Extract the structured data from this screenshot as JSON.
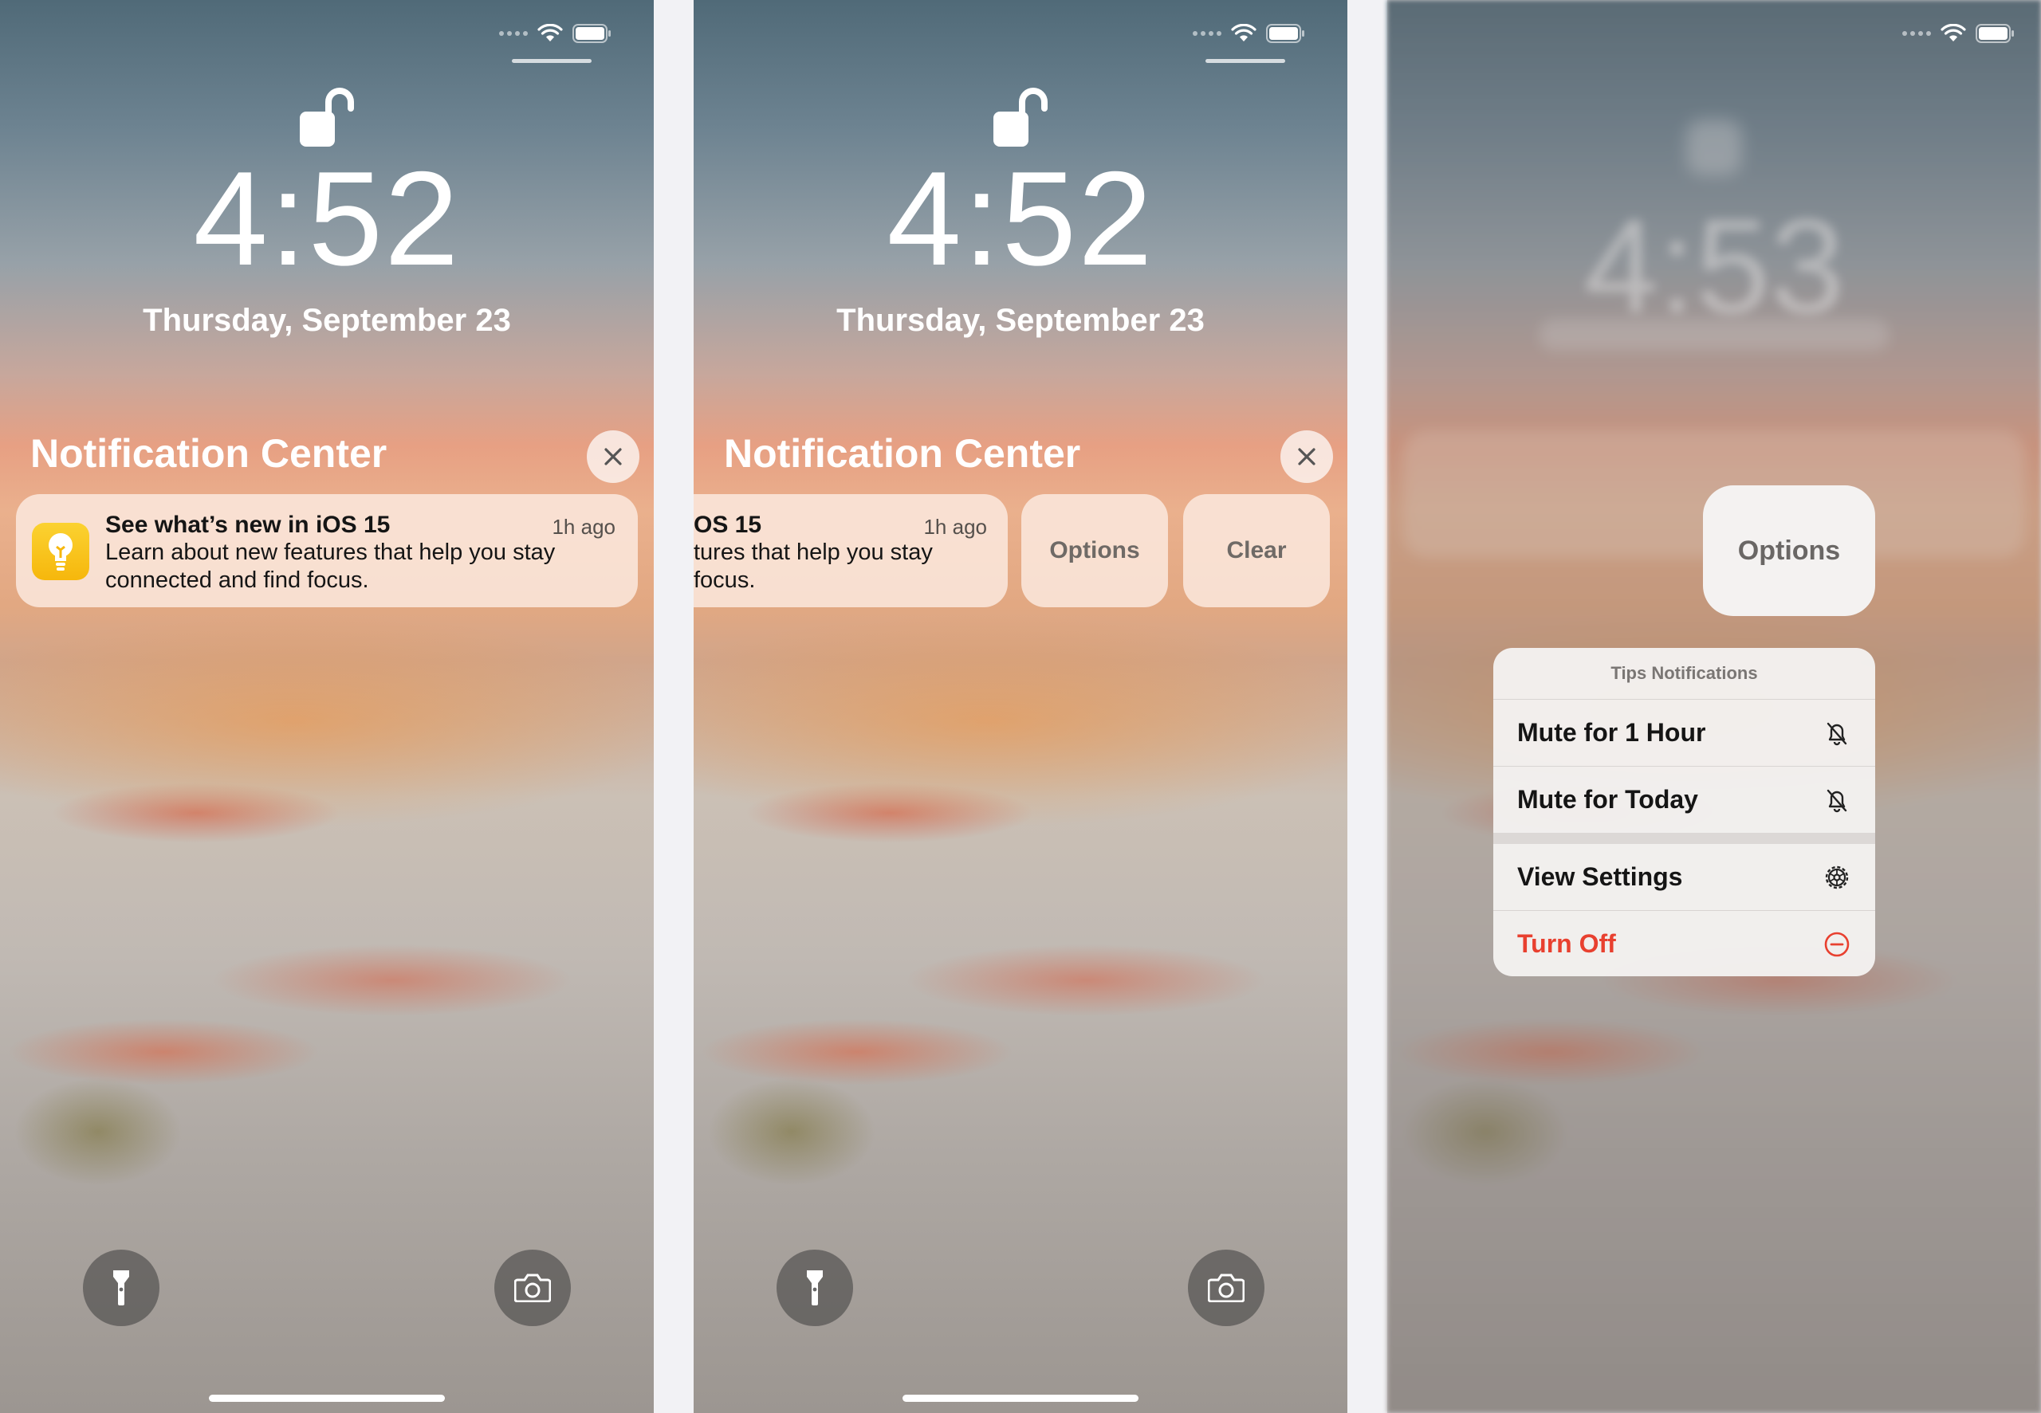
{
  "lockscreen": {
    "time": "4:52",
    "blurred_time": "4:53",
    "date": "Thursday, September 23"
  },
  "notification_center": {
    "title": "Notification Center"
  },
  "notification": {
    "title": "See what’s new in iOS 15",
    "title_clipped": "OS 15",
    "time": "1h ago",
    "body": "Learn about new features that help you stay connected and find focus.",
    "body_clipped_line1": "tures that help you stay",
    "body_clipped_line2": "focus.",
    "app_icon": "lightbulb-icon"
  },
  "actions": {
    "options": "Options",
    "clear": "Clear"
  },
  "menu": {
    "header": "Tips Notifications",
    "items": [
      {
        "label": "Mute for 1 Hour",
        "icon": "bell-slash-icon"
      },
      {
        "label": "Mute for Today",
        "icon": "bell-slash-icon"
      },
      {
        "label": "View Settings",
        "icon": "gear-icon"
      },
      {
        "label": "Turn Off",
        "icon": "minus-circle-icon",
        "color": "#e8402f"
      }
    ]
  },
  "quick_actions": {
    "left": "flashlight-icon",
    "right": "camera-icon"
  },
  "colors": {
    "danger": "#e8402f",
    "notification_bg": "#fce9de",
    "tips_yellow": "#f8c21b"
  }
}
